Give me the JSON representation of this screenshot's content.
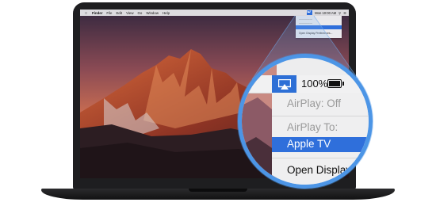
{
  "menubar": {
    "apple_icon": "apple-icon",
    "items": [
      "Finder",
      "File",
      "Edit",
      "View",
      "Go",
      "Window",
      "Help"
    ],
    "clock": "Mon 10:00 AM"
  },
  "mini_menu": {
    "open_text": "Open Display Preferences..."
  },
  "magnified": {
    "battery": "100%",
    "airplay_status": "AirPlay: Off",
    "airplay_to": "AirPlay To:",
    "device": "Apple TV",
    "open_display": "Open Display Preferences..."
  },
  "colors": {
    "accent": "#2f6fdb",
    "ring": "#4c95e6",
    "bezel": "#1e1e20"
  }
}
